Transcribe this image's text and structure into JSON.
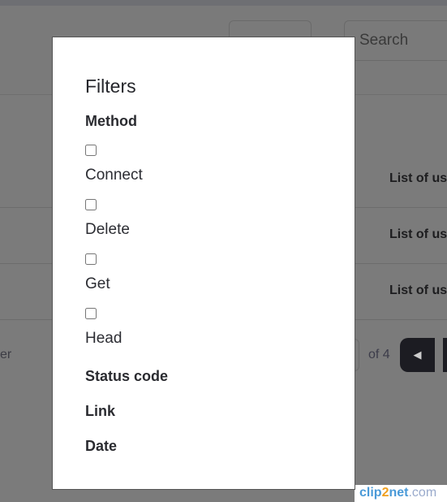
{
  "background": {
    "search_placeholder": "Search",
    "rows": [
      "List of us",
      "List of us",
      "List of us"
    ],
    "footer_left": "er",
    "page_of": "of 4",
    "prev_icon": "caret-left-icon"
  },
  "modal": {
    "title": "Filters",
    "sections": [
      {
        "label": "Method",
        "options": [
          "Connect",
          "Delete",
          "Get",
          "Head"
        ]
      },
      {
        "label": "Status code"
      },
      {
        "label": "Link"
      },
      {
        "label": "Date"
      }
    ]
  },
  "watermark": {
    "text": "clip2net.com"
  }
}
